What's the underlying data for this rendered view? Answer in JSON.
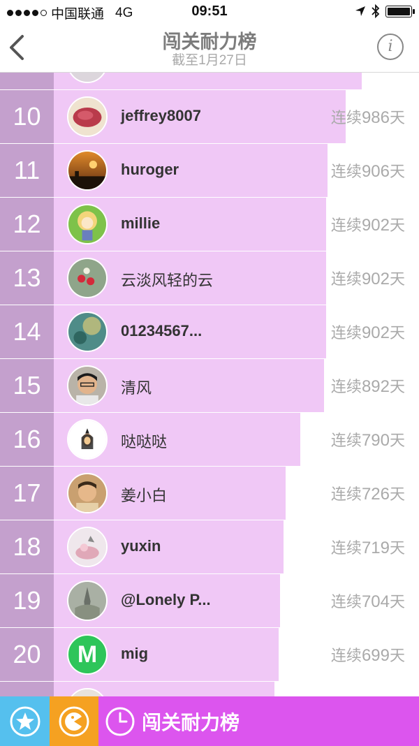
{
  "status": {
    "carrier": "中国联通",
    "network": "4G",
    "time": "09:51"
  },
  "nav": {
    "title": "闯关耐力榜",
    "subtitle": "截至1月27日",
    "info_icon": "i"
  },
  "streak_prefix": "连续",
  "streak_suffix": "天",
  "rows": [
    {
      "rank": "10",
      "name": "jeffrey8007",
      "days": "986",
      "bar_fraction": 0.8
    },
    {
      "rank": "11",
      "name": "huroger",
      "days": "906",
      "bar_fraction": 0.75
    },
    {
      "rank": "12",
      "name": "millie",
      "days": "902",
      "bar_fraction": 0.745
    },
    {
      "rank": "13",
      "name": "云淡风轻的云",
      "days": "902",
      "bar_fraction": 0.745
    },
    {
      "rank": "14",
      "name": "01234567...",
      "days": "902",
      "bar_fraction": 0.745
    },
    {
      "rank": "15",
      "name": "清风",
      "days": "892",
      "bar_fraction": 0.74
    },
    {
      "rank": "16",
      "name": "哒哒哒",
      "days": "790",
      "bar_fraction": 0.675
    },
    {
      "rank": "17",
      "name": "姜小白",
      "days": "726",
      "bar_fraction": 0.635
    },
    {
      "rank": "18",
      "name": "yuxin",
      "days": "719",
      "bar_fraction": 0.63
    },
    {
      "rank": "19",
      "name": "@Lonely P...",
      "days": "704",
      "bar_fraction": 0.62
    },
    {
      "rank": "20",
      "name": "mig",
      "days": "699",
      "bar_fraction": 0.615
    }
  ],
  "avatar_letter_20": "M",
  "tabs": {
    "active_label": "闯关耐力榜"
  },
  "colors": {
    "rank_cell": "#c4a0cd",
    "bar": "#f0c8f6",
    "tab_star": "#55c0ee",
    "tab_game": "#f5a121",
    "tab_active": "#dc55ee"
  }
}
